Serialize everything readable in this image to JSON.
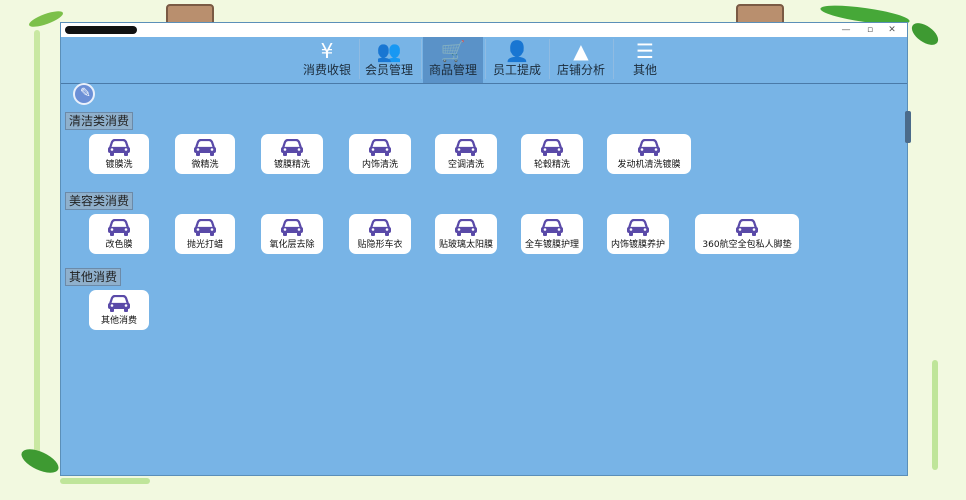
{
  "window": {
    "buttons": [
      "—",
      "▫",
      "✕"
    ]
  },
  "nav": {
    "items": [
      {
        "label": "消费收银",
        "icon": "yen-icon",
        "glyph": "¥",
        "active": false
      },
      {
        "label": "会员管理",
        "icon": "members-icon",
        "glyph": "👥",
        "active": false
      },
      {
        "label": "商品管理",
        "icon": "cart-icon",
        "glyph": "🛒",
        "active": true
      },
      {
        "label": "员工提成",
        "icon": "staff-icon",
        "glyph": "👤",
        "active": false
      },
      {
        "label": "店铺分析",
        "icon": "chart-icon",
        "glyph": "▲",
        "active": false
      },
      {
        "label": "其他",
        "icon": "menu-icon",
        "glyph": "☰",
        "active": false
      }
    ]
  },
  "categories": [
    {
      "label": "清洁类消费",
      "items": [
        "镀膜洗",
        "微精洗",
        "镀膜精洗",
        "内饰清洗",
        "空调清洗",
        "轮毂精洗",
        "发动机清洗镀膜"
      ]
    },
    {
      "label": "美容类消费",
      "items": [
        "改色膜",
        "抛光打蜡",
        "氧化层去除",
        "贴隐形车衣",
        "贴玻璃太阳膜",
        "全车镀膜护理",
        "内饰镀膜养护",
        "360航空全包私人脚垫"
      ]
    },
    {
      "label": "其他消费",
      "items": [
        "其他消费"
      ]
    }
  ],
  "colors": {
    "window_bg": "#78b4e6",
    "car_icon": "#5a4aa8",
    "active_nav": "#5a92c8"
  }
}
